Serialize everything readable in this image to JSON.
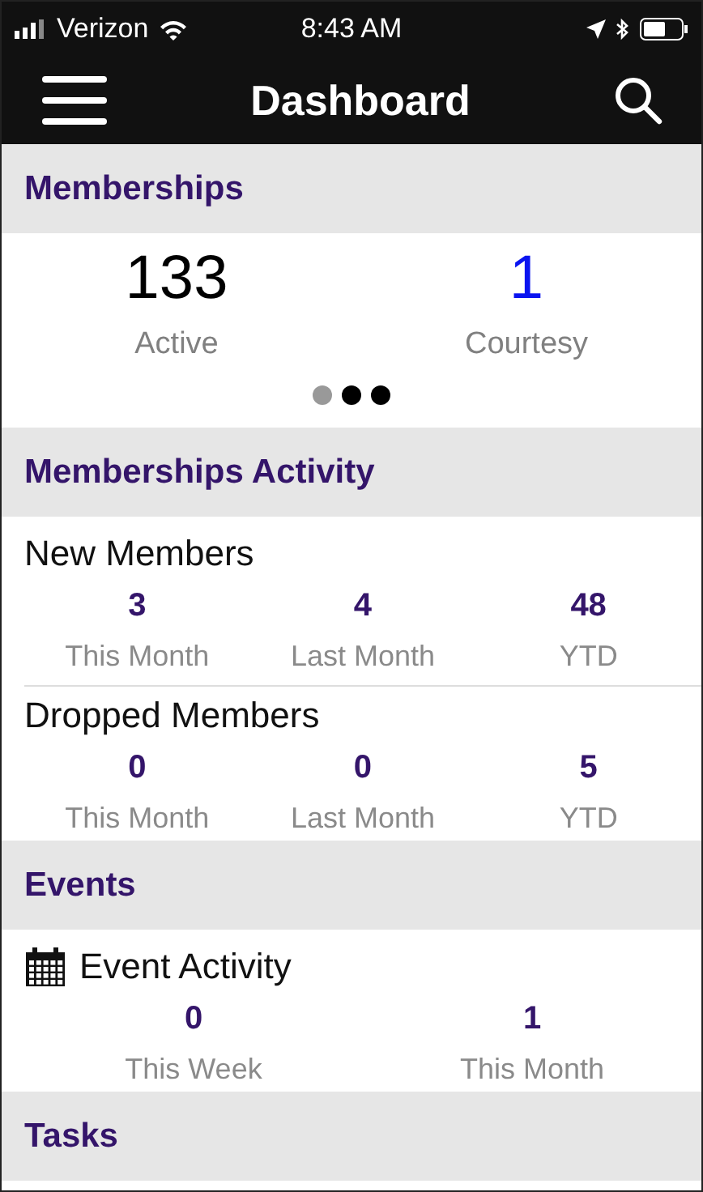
{
  "status_bar": {
    "carrier": "Verizon",
    "time": "8:43 AM"
  },
  "header": {
    "title": "Dashboard"
  },
  "sections": [
    {
      "title": "Memberships",
      "kind": "summary",
      "items": [
        {
          "value": "133",
          "label": "Active",
          "color": "#000000"
        },
        {
          "value": "1",
          "label": "Courtesy",
          "color": "#0a14f0"
        }
      ],
      "pager": [
        {
          "selected": true
        },
        {
          "selected": false
        },
        {
          "selected": false
        }
      ]
    },
    {
      "title": "Memberships Activity",
      "kind": "activity",
      "groups": [
        {
          "title": "New Members",
          "kind": "plain",
          "stats": [
            {
              "value": "3",
              "label": "This Month"
            },
            {
              "value": "4",
              "label": "Last Month"
            },
            {
              "value": "48",
              "label": "YTD"
            }
          ]
        },
        {
          "title": "Dropped Members",
          "kind": "plain",
          "stats": [
            {
              "value": "0",
              "label": "This Month"
            },
            {
              "value": "0",
              "label": "Last Month"
            },
            {
              "value": "5",
              "label": "YTD"
            }
          ]
        }
      ]
    },
    {
      "title": "Events",
      "kind": "activity",
      "groups": [
        {
          "title": "Event Activity",
          "kind": "event",
          "stats": [
            {
              "value": "0",
              "label": "This Week"
            },
            {
              "value": "1",
              "label": "This Month"
            }
          ]
        }
      ]
    },
    {
      "title": "Tasks",
      "kind": "header"
    }
  ]
}
